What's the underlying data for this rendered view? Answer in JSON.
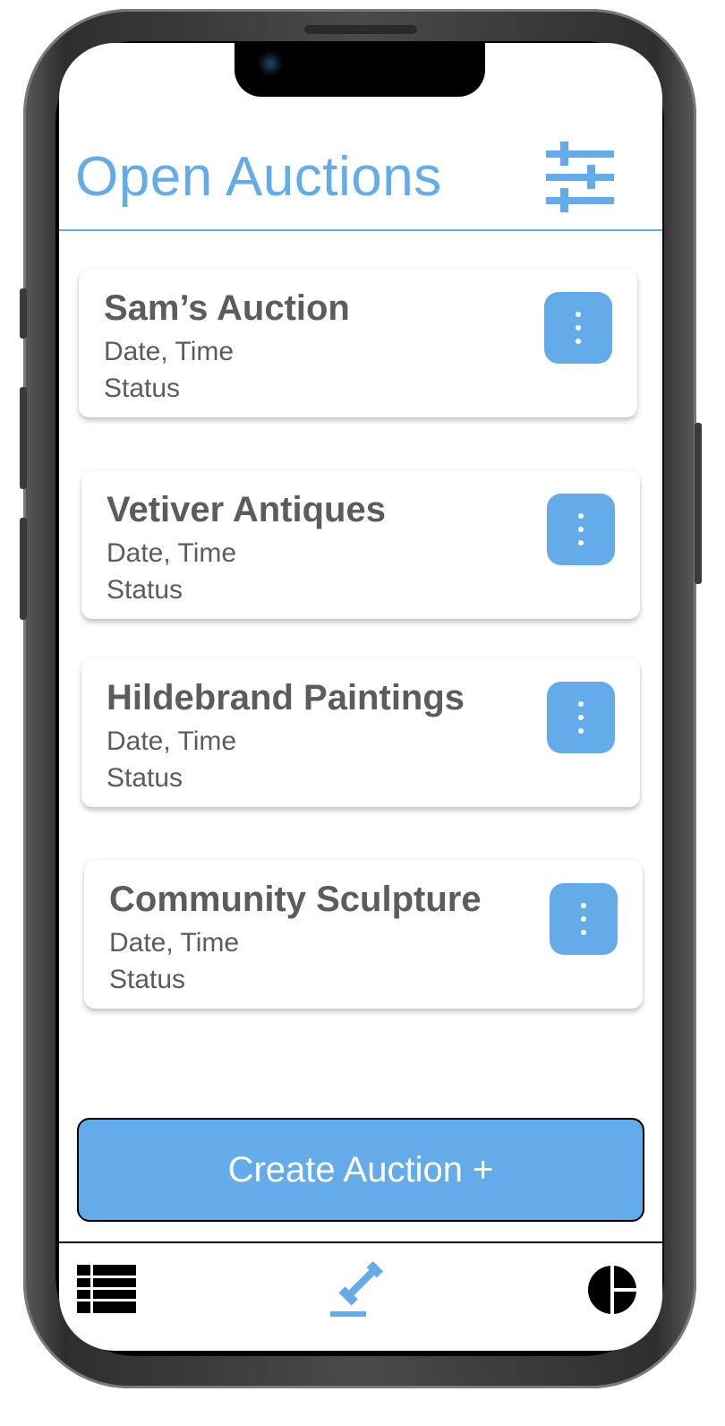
{
  "header": {
    "title": "Open Auctions",
    "filter_icon": "sliders-icon"
  },
  "auctions": [
    {
      "name": "Sam’s Auction",
      "datetime": "Date, Time",
      "status": "Status"
    },
    {
      "name": "Vetiver Antiques",
      "datetime": "Date, Time",
      "status": "Status"
    },
    {
      "name": "Hildebrand Paintings",
      "datetime": "Date, Time",
      "status": "Status"
    },
    {
      "name": "Community Sculpture",
      "datetime": "Date, Time",
      "status": "Status"
    }
  ],
  "create_button": {
    "label": "Create Auction +"
  },
  "nav": {
    "items": [
      {
        "icon": "list-icon",
        "active": false
      },
      {
        "icon": "gavel-icon",
        "active": true
      },
      {
        "icon": "pie-chart-icon",
        "active": false
      }
    ]
  },
  "colors": {
    "accent": "#64ace9",
    "text": "#5c5c5c",
    "nav_inactive": "#000000"
  }
}
